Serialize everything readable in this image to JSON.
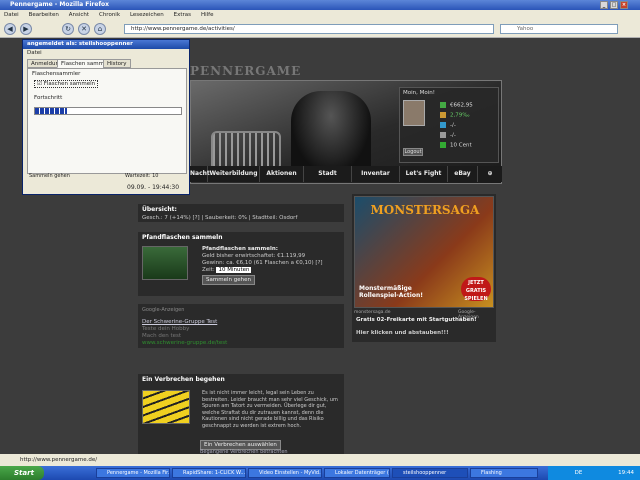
{
  "browser": {
    "title": "Pennergame - Mozilla Firefox",
    "menu": [
      "Datei",
      "Bearbeiten",
      "Ansicht",
      "Chronik",
      "Lesezeichen",
      "Extras",
      "Hilfe"
    ],
    "url": "http://www.pennergame.de/activities/",
    "search_placeholder": "Yahoo",
    "status_text": "http://www.pennergame.de/"
  },
  "addon": {
    "title": "angemeldet als: steilshooppenner",
    "menu": "Datei",
    "tabs": [
      "Anmeldung",
      "Flaschen sammeln",
      "History"
    ],
    "group_label": "Flaschensammler",
    "checkbox_label": "Flaschen sammeln",
    "progress_label": "Fortschritt",
    "progress_fraction": 0.22,
    "status_left": "Sammeln gehen",
    "wait_label": "Wartezeit:",
    "wait_value": "10",
    "timestamp": "09.09. - 19:44:30"
  },
  "site": {
    "logo": "PENNERGAME",
    "user_greeting": "Moin, Moin!",
    "stats": [
      {
        "icon": "money-icon",
        "text": "€662,95"
      },
      {
        "icon": "promille-icon",
        "text": "2,79‰"
      },
      {
        "icon": "clean-icon",
        "text": "-/-"
      },
      {
        "icon": "cross-icon",
        "text": "-/-"
      },
      {
        "icon": "arrow-up-icon",
        "text": "10 Cent"
      }
    ],
    "logout": "Logout",
    "nav": [
      "Nacht",
      "Weiterbildung",
      "Aktionen",
      "Stadt",
      "Inventar",
      "Let's Fight",
      "eBay"
    ],
    "overview_title": "Übersicht:",
    "overview_text": "Gesch.: 7 (+14%) [?] | Sauberkeit: 0% | Stadtteil: Osdorf",
    "bottles_title": "Pfandflaschen sammeln",
    "bottles_heading": "Pfandflaschen sammeln:",
    "bottles_line1": "Geld bisher erwirtschaftet: €1.119,99",
    "bottles_line2": "Gewinn: ca. €6,10 (61 Flaschen a €0,10) [?]",
    "bottles_time_label": "Zeit:",
    "bottles_time_value": "10 Minuten",
    "bottles_button": "Sammeln gehen",
    "google_label": "Google-Anzeigen",
    "google_link": "Der Schwerine-Gruppe Test",
    "google_line2": "Teste dein Hobby",
    "google_line3": "Mach den test",
    "google_green": "www.schwerine-gruppe.de/test",
    "crime_title": "Ein Verbrechen begehen",
    "crime_text": "Es ist nicht immer leicht, legal sein Leben zu bestreiten. Leider braucht man sehr viel Geschick, um Spuren am Tatort zu vermeiden. Überlege dir gut, welche Straftat du dir zutrauen kannst, denn die Kautionen sind nicht gerade billig und das Risiko geschnappt zu werden ist extrem hoch.",
    "crime_button": "Ein Verbrechen auswählen",
    "crime_link": "Begangene Verbrechen betrachten",
    "ad_logo": "MONSTERSAGA",
    "ad_tagline": "Monstermäßige Rollenspiel-Action!",
    "ad_badge": "JETZT GRATIS SPIELEN",
    "ad_source": "monstersaga.de",
    "ad_google": "Google-Anzeigen",
    "ad_title": "Gratis 02-Freikarte mit Startguthaben!",
    "ad_link": "Hier klicken und abstauben!!!"
  },
  "taskbar": {
    "start": "Start",
    "tasks": [
      "Pennergame - Mozilla Fir...",
      "RapidShare: 1-CLICK W...",
      "Video Einstellen - MyVid...",
      "Lokaler Datenträger (D:)...",
      "steilshooppenner",
      "Flashing"
    ],
    "active_task": 4,
    "lang": "DE",
    "clock": "19:44"
  }
}
